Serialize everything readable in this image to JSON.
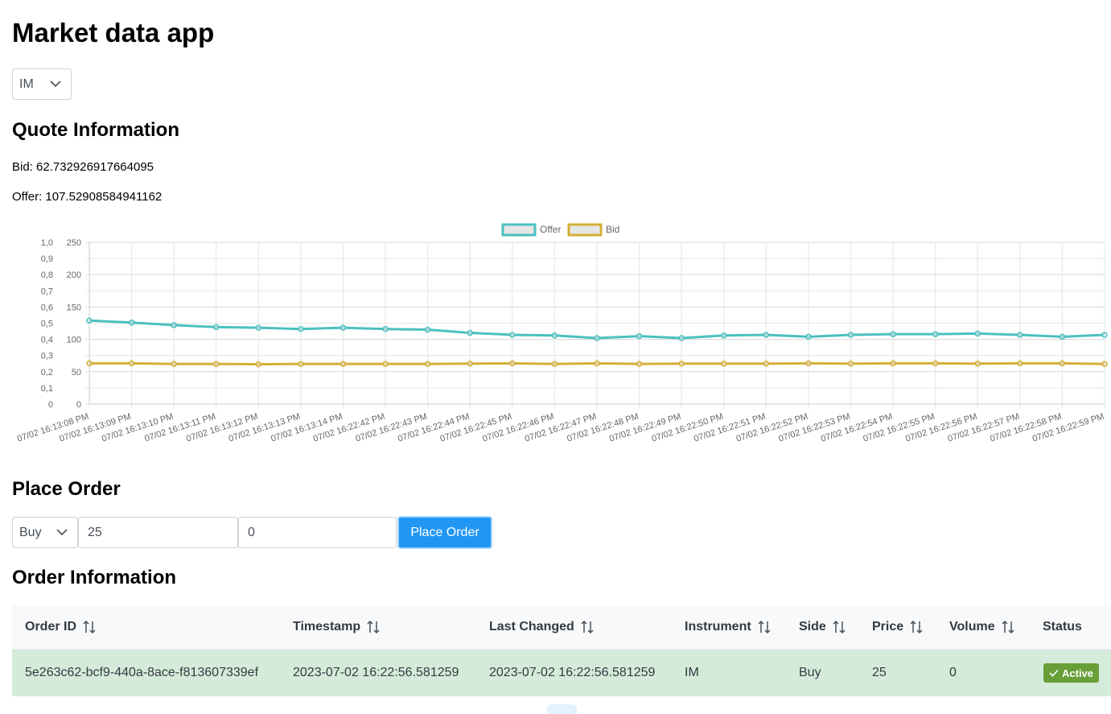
{
  "app": {
    "title": "Market data app"
  },
  "instrument_select": {
    "value": "IM"
  },
  "quote": {
    "heading": "Quote Information",
    "bid_text": "Bid: 62.732926917664095",
    "offer_text": "Offer: 107.52908584941162"
  },
  "chart_data": {
    "type": "line",
    "legend_position": "top",
    "grid": true,
    "x": [
      "07/02 16:13:08 PM",
      "07/02 16:13:09 PM",
      "07/02 16:13:10 PM",
      "07/02 16:13:11 PM",
      "07/02 16:13:12 PM",
      "07/02 16:13:13 PM",
      "07/02 16:13:14 PM",
      "07/02 16:22:42 PM",
      "07/02 16:22:43 PM",
      "07/02 16:22:44 PM",
      "07/02 16:22:45 PM",
      "07/02 16:22:46 PM",
      "07/02 16:22:47 PM",
      "07/02 16:22:48 PM",
      "07/02 16:22:49 PM",
      "07/02 16:22:50 PM",
      "07/02 16:22:51 PM",
      "07/02 16:22:52 PM",
      "07/02 16:22:53 PM",
      "07/02 16:22:54 PM",
      "07/02 16:22:55 PM",
      "07/02 16:22:56 PM",
      "07/02 16:22:57 PM",
      "07/02 16:22:58 PM",
      "07/02 16:22:59 PM"
    ],
    "series": [
      {
        "name": "Offer",
        "color": "#4bc0c0",
        "values": [
          129,
          126,
          122,
          119,
          118,
          116,
          118,
          116,
          115,
          110,
          107,
          106,
          102,
          105,
          102,
          106,
          107,
          104,
          107,
          108,
          108,
          109,
          107,
          104,
          107
        ]
      },
      {
        "name": "Bid",
        "color": "#d4af37",
        "values": [
          63,
          63,
          62,
          62,
          61.5,
          62,
          62,
          62,
          62,
          62.5,
          63,
          62,
          63,
          62,
          62.5,
          62.5,
          62.5,
          63,
          62.5,
          63,
          63,
          62.5,
          63,
          63,
          62
        ]
      }
    ],
    "left_axis": {
      "ticks": [
        "1,0",
        "0,9",
        "0,8",
        "0,7",
        "0,6",
        "0,5",
        "0,4",
        "0,3",
        "0,2",
        "0,1",
        "0"
      ],
      "ylim": [
        0,
        1
      ]
    },
    "right_axis": {
      "ticks": [
        "250",
        "200",
        "150",
        "100",
        "50",
        "0"
      ],
      "ylim": [
        0,
        250
      ]
    }
  },
  "place_order": {
    "heading": "Place Order",
    "side_value": "Buy",
    "price_value": "25",
    "volume_value": "0",
    "button_label": "Place Order",
    "button_color": "#2196f3"
  },
  "orders": {
    "heading": "Order Information",
    "columns": [
      "Order ID",
      "Timestamp",
      "Last Changed",
      "Instrument",
      "Side",
      "Price",
      "Volume",
      "Status"
    ],
    "rows": [
      {
        "order_id": "5e263c62-bcf9-440a-8ace-f813607339ef",
        "timestamp": "2023-07-02 16:22:56.581259",
        "last_changed": "2023-07-02 16:22:56.581259",
        "instrument": "IM",
        "side": "Buy",
        "price": "25",
        "volume": "0",
        "status": "Active",
        "row_color": "#d4ebd9",
        "status_color": "#689f38"
      }
    ]
  }
}
